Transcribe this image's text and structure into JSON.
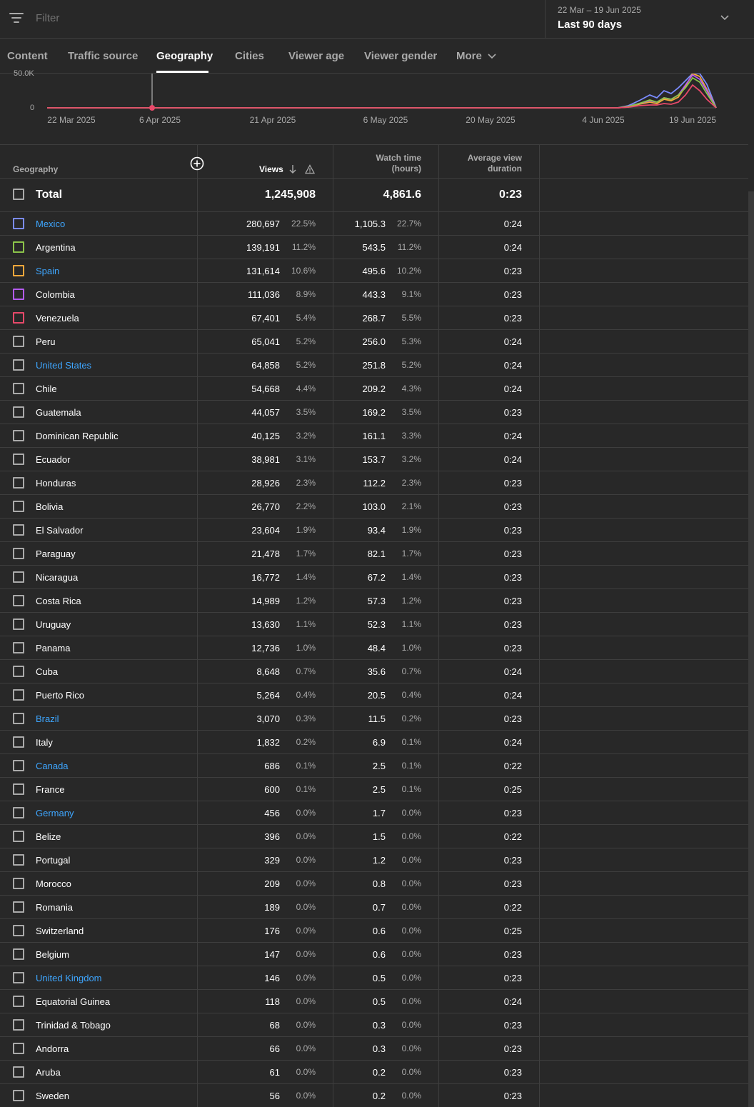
{
  "filter": {
    "placeholder": "Filter"
  },
  "date_range": {
    "range": "22 Mar – 19 Jun 2025",
    "label": "Last 90 days"
  },
  "tabs": [
    {
      "label": "Content",
      "active": false
    },
    {
      "label": "Traffic source",
      "active": false
    },
    {
      "label": "Geography",
      "active": true
    },
    {
      "label": "Cities",
      "active": false
    },
    {
      "label": "Viewer age",
      "active": false
    },
    {
      "label": "Viewer gender",
      "active": false
    },
    {
      "label": "More",
      "active": false
    }
  ],
  "chart_data": {
    "type": "line",
    "y_ticks": [
      "50.0K",
      "0"
    ],
    "x_ticks": [
      "22 Mar 2025",
      "6 Apr 2025",
      "21 Apr 2025",
      "6 May 2025",
      "20 May 2025",
      "4 Jun 2025",
      "19 Jun 2025"
    ],
    "marker_date": "6 Apr 2025",
    "colors": {
      "mexico": "#7b8cff",
      "argentina": "#8bc34a",
      "spain": "#f2a73b",
      "colombia": "#b45cf0",
      "venezuela": "#e8496a"
    }
  },
  "table": {
    "headers": {
      "geography": "Geography",
      "views": "Views",
      "watch_time_1": "Watch time",
      "watch_time_2": "(hours)",
      "avd_1": "Average view",
      "avd_2": "duration"
    },
    "total": {
      "name": "Total",
      "views": "1,245,908",
      "watch": "4,861.6",
      "avd": "0:23"
    },
    "rows": [
      {
        "name": "Mexico",
        "views": "280,697",
        "views_pct": "22.5%",
        "watch": "1,105.3",
        "watch_pct": "22.7%",
        "avd": "0:24",
        "link": true,
        "color": "#7b8cff"
      },
      {
        "name": "Argentina",
        "views": "139,191",
        "views_pct": "11.2%",
        "watch": "543.5",
        "watch_pct": "11.2%",
        "avd": "0:24",
        "link": false,
        "color": "#8bc34a"
      },
      {
        "name": "Spain",
        "views": "131,614",
        "views_pct": "10.6%",
        "watch": "495.6",
        "watch_pct": "10.2%",
        "avd": "0:23",
        "link": true,
        "color": "#f2a73b"
      },
      {
        "name": "Colombia",
        "views": "111,036",
        "views_pct": "8.9%",
        "watch": "443.3",
        "watch_pct": "9.1%",
        "avd": "0:23",
        "link": false,
        "color": "#b45cf0"
      },
      {
        "name": "Venezuela",
        "views": "67,401",
        "views_pct": "5.4%",
        "watch": "268.7",
        "watch_pct": "5.5%",
        "avd": "0:23",
        "link": false,
        "color": "#e8496a"
      },
      {
        "name": "Peru",
        "views": "65,041",
        "views_pct": "5.2%",
        "watch": "256.0",
        "watch_pct": "5.3%",
        "avd": "0:24",
        "link": false,
        "color": ""
      },
      {
        "name": "United States",
        "views": "64,858",
        "views_pct": "5.2%",
        "watch": "251.8",
        "watch_pct": "5.2%",
        "avd": "0:24",
        "link": true,
        "color": ""
      },
      {
        "name": "Chile",
        "views": "54,668",
        "views_pct": "4.4%",
        "watch": "209.2",
        "watch_pct": "4.3%",
        "avd": "0:24",
        "link": false,
        "color": ""
      },
      {
        "name": "Guatemala",
        "views": "44,057",
        "views_pct": "3.5%",
        "watch": "169.2",
        "watch_pct": "3.5%",
        "avd": "0:23",
        "link": false,
        "color": ""
      },
      {
        "name": "Dominican Republic",
        "views": "40,125",
        "views_pct": "3.2%",
        "watch": "161.1",
        "watch_pct": "3.3%",
        "avd": "0:24",
        "link": false,
        "color": ""
      },
      {
        "name": "Ecuador",
        "views": "38,981",
        "views_pct": "3.1%",
        "watch": "153.7",
        "watch_pct": "3.2%",
        "avd": "0:24",
        "link": false,
        "color": ""
      },
      {
        "name": "Honduras",
        "views": "28,926",
        "views_pct": "2.3%",
        "watch": "112.2",
        "watch_pct": "2.3%",
        "avd": "0:23",
        "link": false,
        "color": ""
      },
      {
        "name": "Bolivia",
        "views": "26,770",
        "views_pct": "2.2%",
        "watch": "103.0",
        "watch_pct": "2.1%",
        "avd": "0:23",
        "link": false,
        "color": ""
      },
      {
        "name": "El Salvador",
        "views": "23,604",
        "views_pct": "1.9%",
        "watch": "93.4",
        "watch_pct": "1.9%",
        "avd": "0:23",
        "link": false,
        "color": ""
      },
      {
        "name": "Paraguay",
        "views": "21,478",
        "views_pct": "1.7%",
        "watch": "82.1",
        "watch_pct": "1.7%",
        "avd": "0:23",
        "link": false,
        "color": ""
      },
      {
        "name": "Nicaragua",
        "views": "16,772",
        "views_pct": "1.4%",
        "watch": "67.2",
        "watch_pct": "1.4%",
        "avd": "0:23",
        "link": false,
        "color": ""
      },
      {
        "name": "Costa Rica",
        "views": "14,989",
        "views_pct": "1.2%",
        "watch": "57.3",
        "watch_pct": "1.2%",
        "avd": "0:23",
        "link": false,
        "color": ""
      },
      {
        "name": "Uruguay",
        "views": "13,630",
        "views_pct": "1.1%",
        "watch": "52.3",
        "watch_pct": "1.1%",
        "avd": "0:23",
        "link": false,
        "color": ""
      },
      {
        "name": "Panama",
        "views": "12,736",
        "views_pct": "1.0%",
        "watch": "48.4",
        "watch_pct": "1.0%",
        "avd": "0:23",
        "link": false,
        "color": ""
      },
      {
        "name": "Cuba",
        "views": "8,648",
        "views_pct": "0.7%",
        "watch": "35.6",
        "watch_pct": "0.7%",
        "avd": "0:24",
        "link": false,
        "color": ""
      },
      {
        "name": "Puerto Rico",
        "views": "5,264",
        "views_pct": "0.4%",
        "watch": "20.5",
        "watch_pct": "0.4%",
        "avd": "0:24",
        "link": false,
        "color": ""
      },
      {
        "name": "Brazil",
        "views": "3,070",
        "views_pct": "0.3%",
        "watch": "11.5",
        "watch_pct": "0.2%",
        "avd": "0:23",
        "link": true,
        "color": ""
      },
      {
        "name": "Italy",
        "views": "1,832",
        "views_pct": "0.2%",
        "watch": "6.9",
        "watch_pct": "0.1%",
        "avd": "0:24",
        "link": false,
        "color": ""
      },
      {
        "name": "Canada",
        "views": "686",
        "views_pct": "0.1%",
        "watch": "2.5",
        "watch_pct": "0.1%",
        "avd": "0:22",
        "link": true,
        "color": ""
      },
      {
        "name": "France",
        "views": "600",
        "views_pct": "0.1%",
        "watch": "2.5",
        "watch_pct": "0.1%",
        "avd": "0:25",
        "link": false,
        "color": ""
      },
      {
        "name": "Germany",
        "views": "456",
        "views_pct": "0.0%",
        "watch": "1.7",
        "watch_pct": "0.0%",
        "avd": "0:23",
        "link": true,
        "color": ""
      },
      {
        "name": "Belize",
        "views": "396",
        "views_pct": "0.0%",
        "watch": "1.5",
        "watch_pct": "0.0%",
        "avd": "0:22",
        "link": false,
        "color": ""
      },
      {
        "name": "Portugal",
        "views": "329",
        "views_pct": "0.0%",
        "watch": "1.2",
        "watch_pct": "0.0%",
        "avd": "0:23",
        "link": false,
        "color": ""
      },
      {
        "name": "Morocco",
        "views": "209",
        "views_pct": "0.0%",
        "watch": "0.8",
        "watch_pct": "0.0%",
        "avd": "0:23",
        "link": false,
        "color": ""
      },
      {
        "name": "Romania",
        "views": "189",
        "views_pct": "0.0%",
        "watch": "0.7",
        "watch_pct": "0.0%",
        "avd": "0:22",
        "link": false,
        "color": ""
      },
      {
        "name": "Switzerland",
        "views": "176",
        "views_pct": "0.0%",
        "watch": "0.6",
        "watch_pct": "0.0%",
        "avd": "0:25",
        "link": false,
        "color": ""
      },
      {
        "name": "Belgium",
        "views": "147",
        "views_pct": "0.0%",
        "watch": "0.6",
        "watch_pct": "0.0%",
        "avd": "0:23",
        "link": false,
        "color": ""
      },
      {
        "name": "United Kingdom",
        "views": "146",
        "views_pct": "0.0%",
        "watch": "0.5",
        "watch_pct": "0.0%",
        "avd": "0:23",
        "link": true,
        "color": ""
      },
      {
        "name": "Equatorial Guinea",
        "views": "118",
        "views_pct": "0.0%",
        "watch": "0.5",
        "watch_pct": "0.0%",
        "avd": "0:24",
        "link": false,
        "color": ""
      },
      {
        "name": "Trinidad & Tobago",
        "views": "68",
        "views_pct": "0.0%",
        "watch": "0.3",
        "watch_pct": "0.0%",
        "avd": "0:23",
        "link": false,
        "color": ""
      },
      {
        "name": "Andorra",
        "views": "66",
        "views_pct": "0.0%",
        "watch": "0.3",
        "watch_pct": "0.0%",
        "avd": "0:23",
        "link": false,
        "color": ""
      },
      {
        "name": "Aruba",
        "views": "61",
        "views_pct": "0.0%",
        "watch": "0.2",
        "watch_pct": "0.0%",
        "avd": "0:23",
        "link": false,
        "color": ""
      },
      {
        "name": "Sweden",
        "views": "56",
        "views_pct": "0.0%",
        "watch": "0.2",
        "watch_pct": "0.0%",
        "avd": "0:23",
        "link": false,
        "color": ""
      }
    ]
  }
}
